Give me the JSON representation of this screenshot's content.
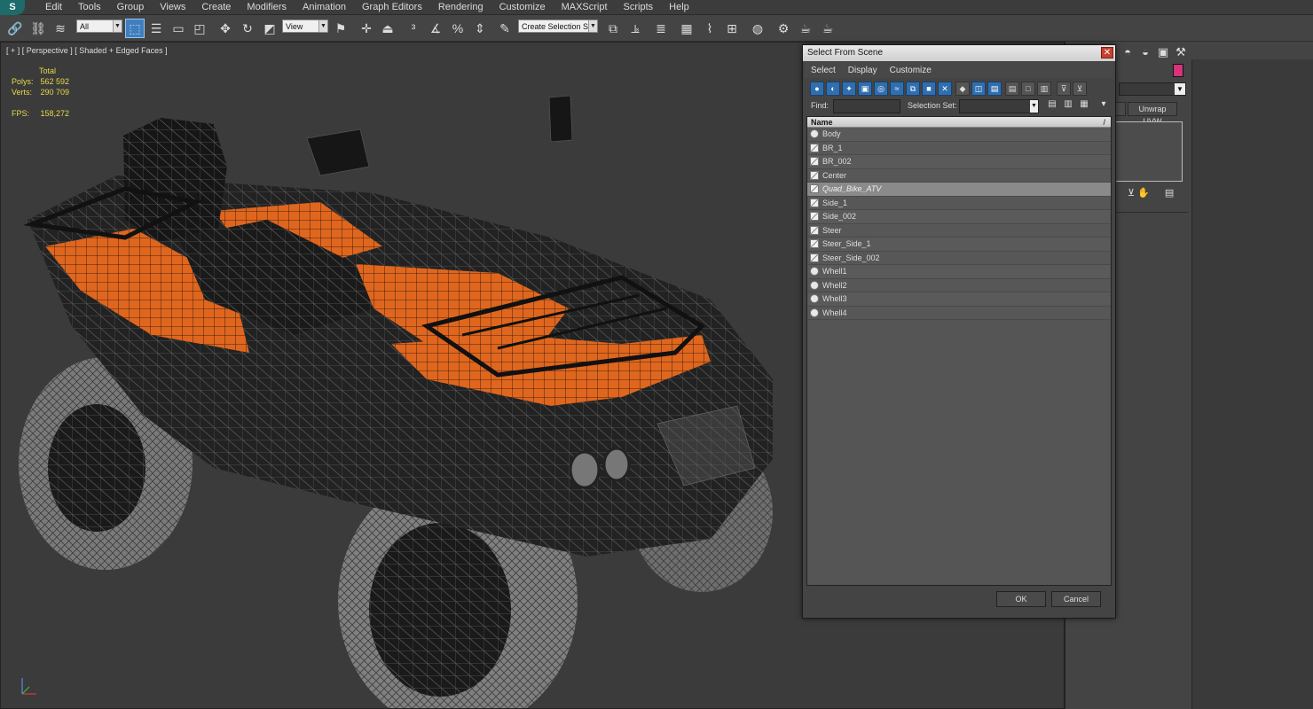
{
  "menubar": {
    "items": [
      "Edit",
      "Tools",
      "Group",
      "Views",
      "Create",
      "Modifiers",
      "Animation",
      "Graph Editors",
      "Rendering",
      "Customize",
      "MAXScript",
      "Scripts",
      "Help"
    ]
  },
  "toolbar": {
    "filter_value": "All",
    "refcoord_value": "View",
    "named_selection_placeholder": "Create Selection Se"
  },
  "viewport": {
    "label": "[ + ] [ Perspective ] [ Shaded + Edged Faces ]",
    "stats": {
      "header": "Total",
      "polys_label": "Polys:",
      "polys_value": "562 592",
      "verts_label": "Verts:",
      "verts_value": "290 709",
      "fps_label": "FPS:",
      "fps_value": "158,272"
    },
    "body_color": "#e0661e"
  },
  "command_panel": {
    "unwrap_label": "Unwrap UVW",
    "swatch_color": "#d6337a"
  },
  "dialog": {
    "title": "Select From Scene",
    "close_glyph": "✕",
    "menu": [
      "Select",
      "Display",
      "Customize"
    ],
    "find_label": "Find:",
    "selection_set_label": "Selection Set:",
    "column_name": "Name",
    "sort_glyph": "/",
    "objects": [
      {
        "name": "Body",
        "type": "mesh",
        "selected": false
      },
      {
        "name": "BR_1",
        "type": "group",
        "selected": false
      },
      {
        "name": "BR_002",
        "type": "group",
        "selected": false
      },
      {
        "name": "Center",
        "type": "group",
        "selected": false
      },
      {
        "name": "Quad_Bike_ATV",
        "type": "group",
        "selected": true
      },
      {
        "name": "Side_1",
        "type": "group",
        "selected": false
      },
      {
        "name": "Side_002",
        "type": "group",
        "selected": false
      },
      {
        "name": "Steer",
        "type": "group",
        "selected": false
      },
      {
        "name": "Steer_Side_1",
        "type": "group",
        "selected": false
      },
      {
        "name": "Steer_Side_002",
        "type": "group",
        "selected": false
      },
      {
        "name": "Whell1",
        "type": "mesh",
        "selected": false
      },
      {
        "name": "Whell2",
        "type": "mesh",
        "selected": false
      },
      {
        "name": "Whell3",
        "type": "mesh",
        "selected": false
      },
      {
        "name": "Whell4",
        "type": "mesh",
        "selected": false
      }
    ],
    "ok_label": "OK",
    "cancel_label": "Cancel"
  }
}
